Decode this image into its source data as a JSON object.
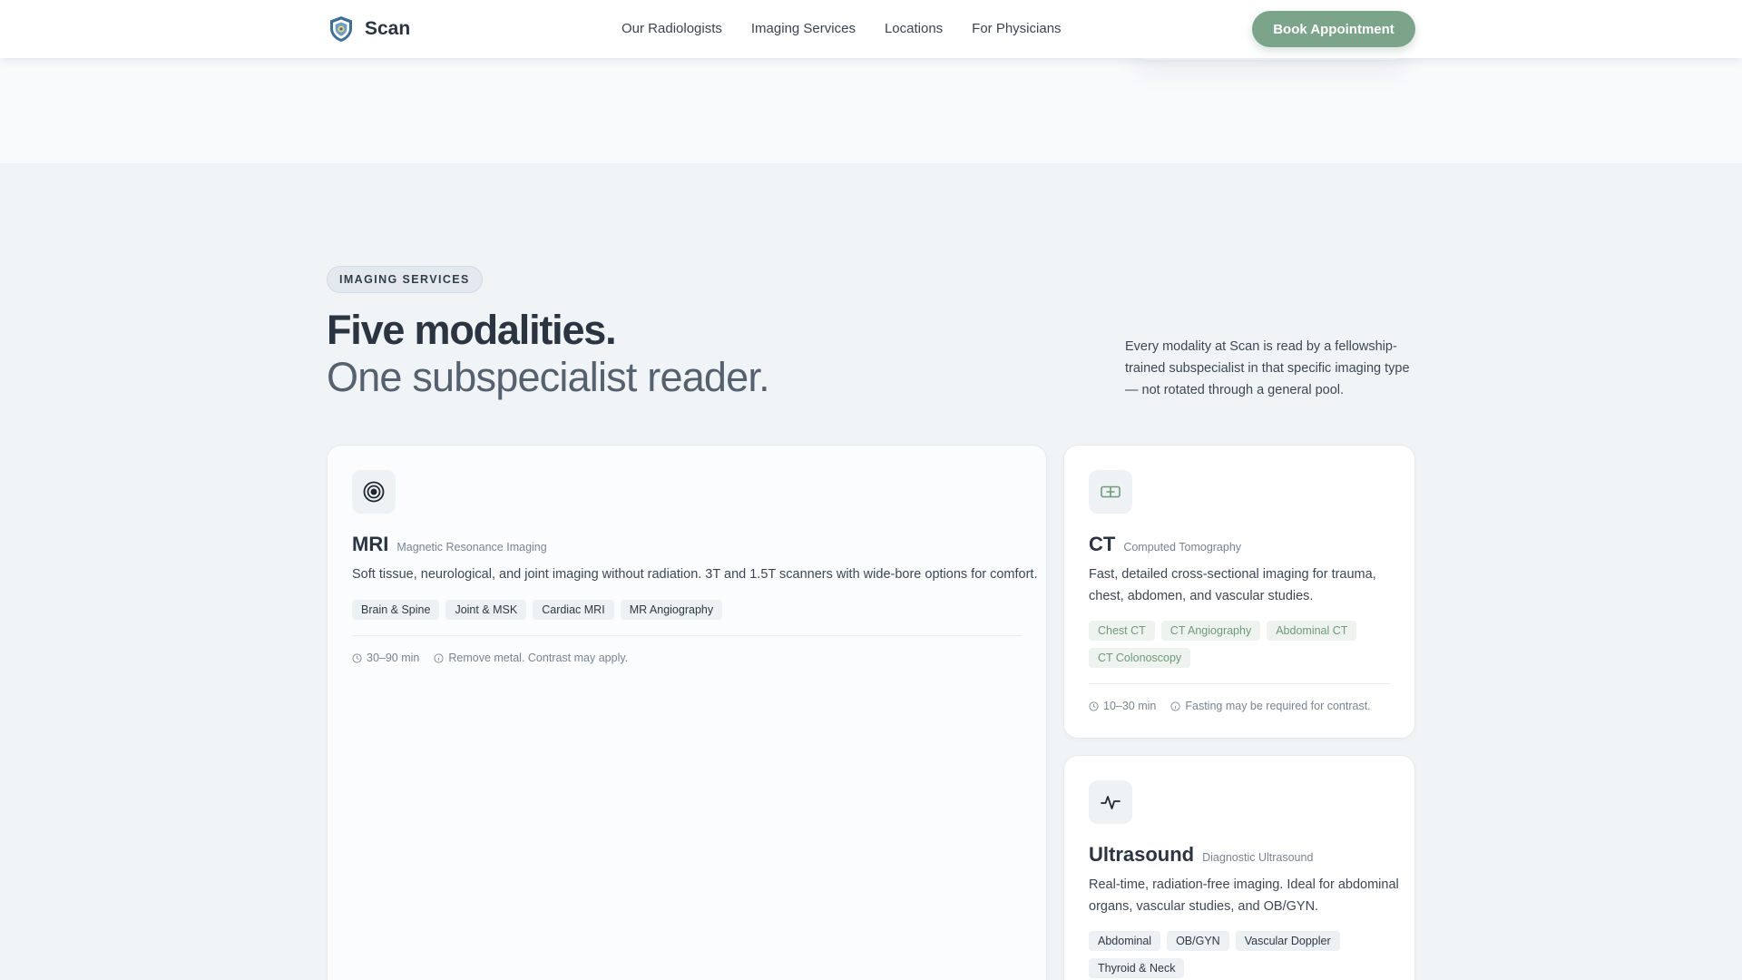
{
  "header": {
    "brand": "Scan",
    "nav": [
      "Our Radiologists",
      "Imaging Services",
      "Locations",
      "For Physicians"
    ],
    "cta": "Book Appointment"
  },
  "section": {
    "eyebrow": "IMAGING SERVICES",
    "headline_1": "Five modalities.",
    "headline_2": "One subspecialist reader.",
    "intro": "Every modality at Scan is read by a fellowship-trained subspecialist in that specific imaging type — not rotated through a general pool."
  },
  "cards": {
    "mri": {
      "icon": "target-icon",
      "title": "MRI",
      "subtitle": "Magnetic Resonance Imaging",
      "description": "Soft tissue, neurological, and joint imaging without radiation. 3T and 1.5T scanners with wide-bore options for comfort.",
      "tags": [
        "Brain & Spine",
        "Joint & MSK",
        "Cardiac MRI",
        "MR Angiography"
      ],
      "duration": "30–90 min",
      "note": "Remove metal. Contrast may apply."
    },
    "ct": {
      "icon": "ct-scanner-icon",
      "title": "CT",
      "subtitle": "Computed Tomography",
      "description_1": "Fast, detailed cross-sectional imaging for trauma,",
      "description_2": "chest, abdomen, and vascular studies.",
      "tags": [
        "Chest CT",
        "CT Angiography",
        "Abdominal CT",
        "CT Colonoscopy"
      ],
      "duration": "10–30 min",
      "note": "Fasting may be required for contrast."
    },
    "ultrasound": {
      "icon": "pulse-icon",
      "title": "Ultrasound",
      "subtitle": "Diagnostic Ultrasound",
      "description_1": "Real-time, radiation-free imaging. Ideal for abdominal",
      "description_2": "organs, vascular studies, and OB/GYN.",
      "tags": [
        "Abdominal",
        "OB/GYN",
        "Vascular Doppler",
        "Thyroid & Neck"
      ]
    }
  },
  "colors": {
    "accent": "#7ba48a",
    "text": "#2b3441",
    "muted": "#7a8491",
    "tag_green_text": "#6f9a7b"
  }
}
